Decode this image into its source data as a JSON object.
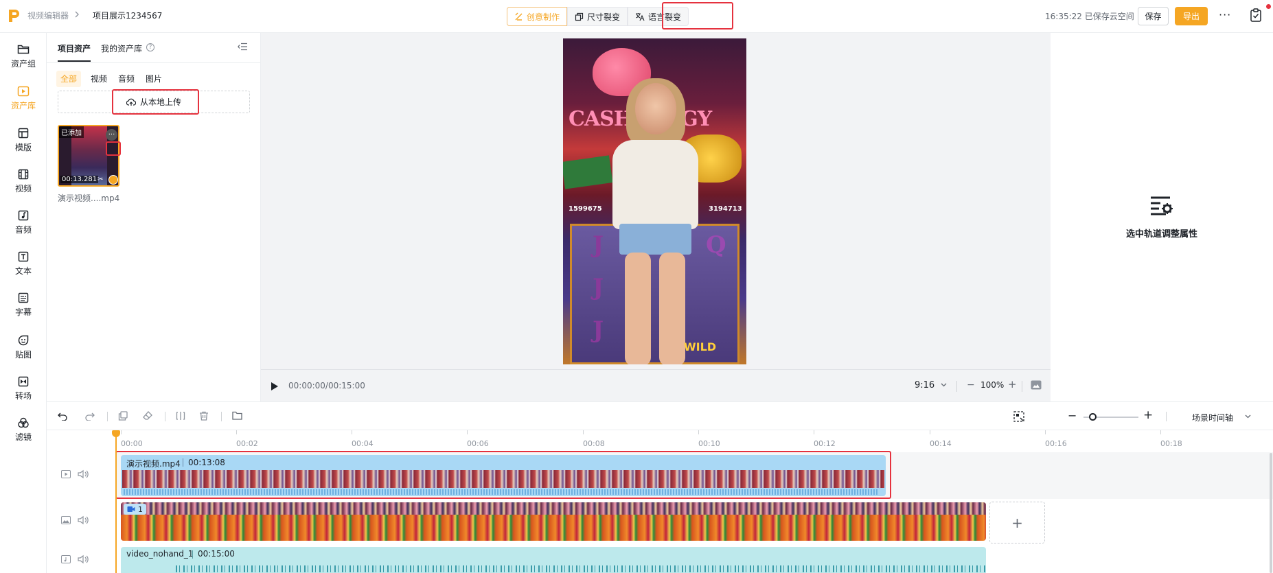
{
  "header": {
    "breadcrumb_parent": "视频编辑器",
    "project_name": "项目展示1234567",
    "modes": [
      {
        "label": "创意制作",
        "active": true
      },
      {
        "label": "尺寸裂变",
        "active": false
      },
      {
        "label": "语言裂变",
        "active": false
      }
    ],
    "save_status": "16:35:22 已保存云空间",
    "save_label": "保存",
    "export_label": "导出",
    "more": "···"
  },
  "sidebar": {
    "items": [
      {
        "label": "资产组",
        "icon": "folder-icon"
      },
      {
        "label": "资产库",
        "icon": "asset-library-icon",
        "active": true
      },
      {
        "label": "模版",
        "icon": "template-icon"
      },
      {
        "label": "视频",
        "icon": "video-film-icon"
      },
      {
        "label": "音频",
        "icon": "music-note-icon"
      },
      {
        "label": "文本",
        "icon": "text-icon"
      },
      {
        "label": "字幕",
        "icon": "subtitle-icon"
      },
      {
        "label": "贴图",
        "icon": "sticker-icon"
      },
      {
        "label": "转场",
        "icon": "transition-icon"
      },
      {
        "label": "滤镜",
        "icon": "filter-icon"
      }
    ]
  },
  "assets": {
    "tab_project": "项目资产",
    "tab_mine": "我的资产库",
    "help": "?",
    "filters": [
      "全部",
      "视频",
      "音频",
      "图片"
    ],
    "upload_label": "从本地上传",
    "item": {
      "badge": "已添加",
      "duration": "00:13.281",
      "name": "演示视频....mp4"
    }
  },
  "preview": {
    "timecode": "00:00:00/00:15:00",
    "aspect_ratio": "9:16",
    "zoom_minus": "−",
    "zoom": "100%",
    "zoom_plus": "+",
    "video_text": {
      "title": "CASH",
      "title_rest": "GY",
      "num_left": "1599675",
      "num_right": "3194713",
      "symbol_j": "J",
      "symbol_q": "Q",
      "wild": "WILD"
    }
  },
  "properties": {
    "empty_hint": "选中轨道调整属性"
  },
  "timeline": {
    "zoom_minus": "−",
    "zoom_plus": "+",
    "zoom_level": 0.18,
    "scene_axis": "场景时间轴",
    "ruler": [
      "00:00",
      "00:02",
      "00:04",
      "00:06",
      "00:08",
      "00:10",
      "00:12",
      "00:14",
      "00:16",
      "00:18"
    ],
    "clip_main": {
      "name": "演示视频.mp4",
      "duration": "00:13:08"
    },
    "clip_overlay": {
      "badge": "1"
    },
    "add_label": "+",
    "clip_audio": {
      "name": "video_nohand_1",
      "duration": "00:15:00"
    }
  },
  "colors": {
    "accent": "#f5a623",
    "highlight": "#e5323e",
    "clip_video": "#a9d8f5",
    "clip_audio": "#bde9ec"
  }
}
